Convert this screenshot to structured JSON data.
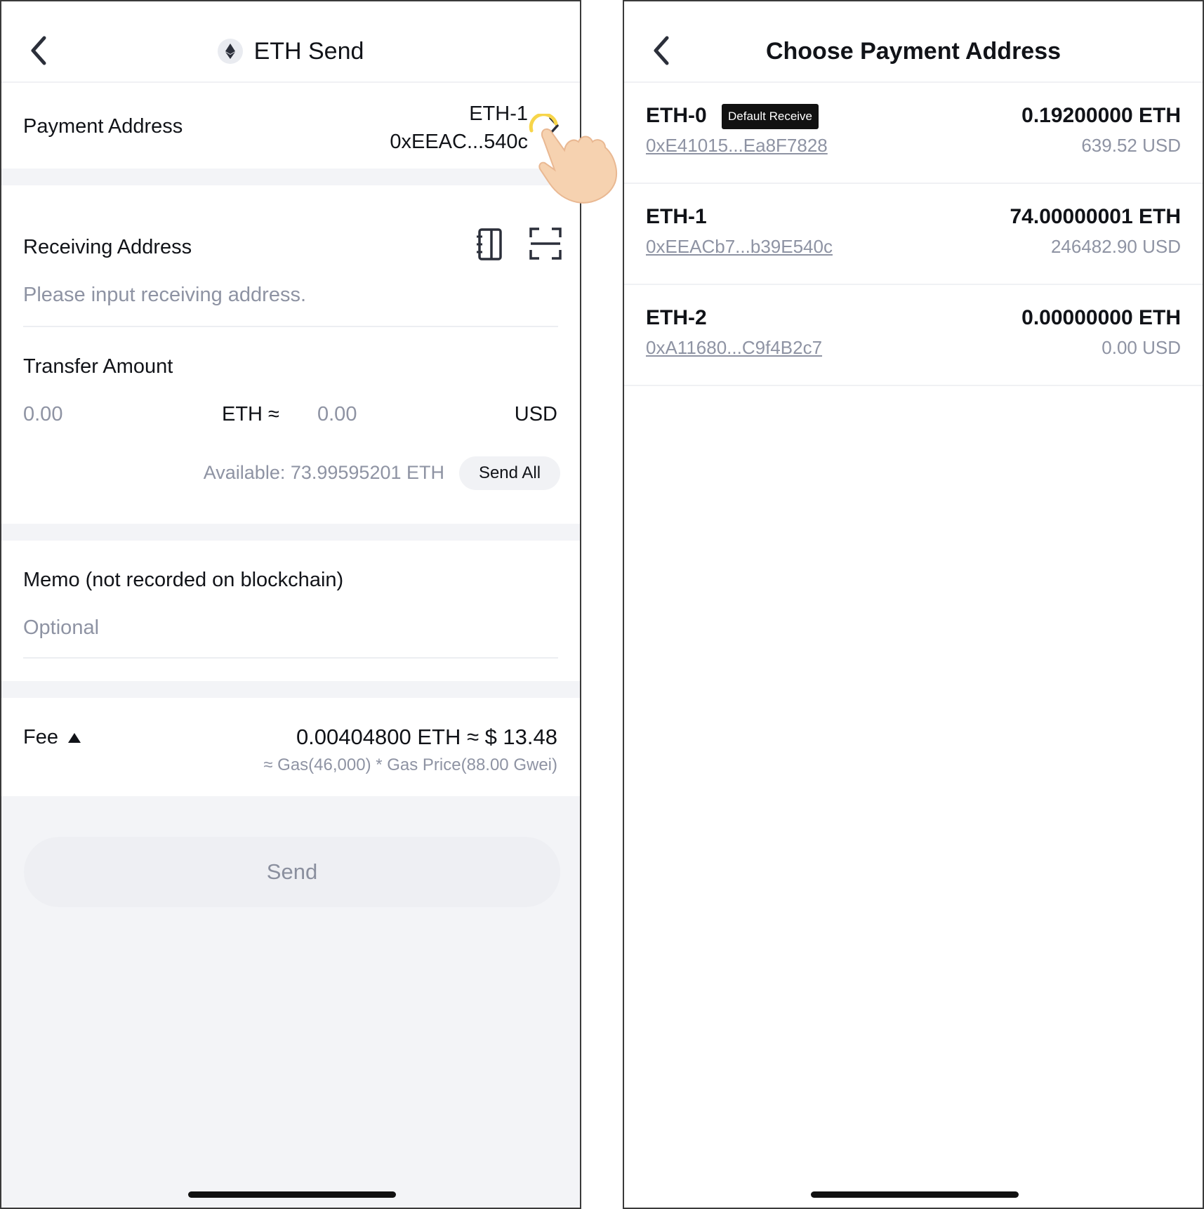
{
  "send_screen": {
    "title": "ETH Send",
    "payment_address": {
      "label": "Payment Address",
      "account_name": "ETH-1",
      "address_short": "0xEEAC...540c"
    },
    "receiving_address": {
      "label": "Receiving Address",
      "placeholder": "Please input receiving address."
    },
    "transfer_amount": {
      "label": "Transfer Amount",
      "eth_value": "0.00",
      "eth_unit": "ETH ≈",
      "usd_value": "0.00",
      "usd_unit": "USD",
      "available": "Available: 73.99595201 ETH",
      "send_all_label": "Send All"
    },
    "memo": {
      "label": "Memo (not recorded on blockchain)",
      "placeholder": "Optional"
    },
    "fee": {
      "label": "Fee",
      "value": "0.00404800 ETH ≈ $ 13.48",
      "detail": "≈ Gas(46,000) * Gas Price(88.00 Gwei)"
    },
    "send_label": "Send"
  },
  "choose_screen": {
    "title": "Choose Payment Address",
    "addresses": [
      {
        "name": "ETH-0",
        "badge": "Default Receive",
        "address": "0xE41015...Ea8F7828",
        "eth": "0.19200000 ETH",
        "usd": "639.52 USD"
      },
      {
        "name": "ETH-1",
        "badge": "",
        "address": "0xEEACb7...b39E540c",
        "eth": "74.00000001 ETH",
        "usd": "246482.90 USD"
      },
      {
        "name": "ETH-2",
        "badge": "",
        "address": "0xA11680...C9f4B2c7",
        "eth": "0.00000000 ETH",
        "usd": "0.00 USD"
      }
    ]
  },
  "colors": {
    "text_primary": "#111318",
    "text_muted": "#8e93a3",
    "section_gap": "#f3f4f7",
    "badge_bg": "#111111",
    "tap_highlight": "#f7d54a",
    "hand_skin": "#f6d2b0"
  },
  "icons": [
    "back-chevron-icon",
    "eth-logo-icon",
    "chevron-right-icon",
    "address-book-icon",
    "scan-icon",
    "triangle-up-icon",
    "pointing-hand-icon"
  ]
}
